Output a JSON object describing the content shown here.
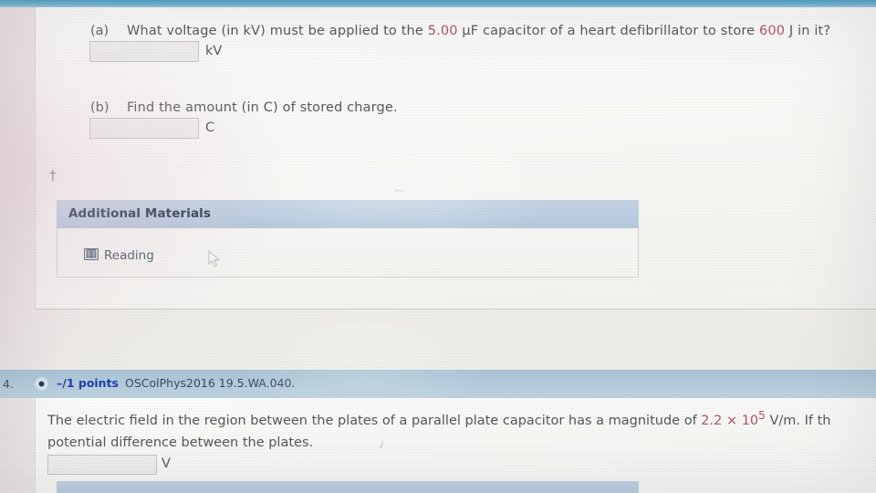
{
  "page": {
    "app": "online-homework-question-view"
  },
  "question3": {
    "parts": [
      {
        "label": "(a)",
        "text_before": "What voltage (in kV) must be applied to the ",
        "value1": "5.00",
        "text_mid": " µF capacitor of a heart defibrillator to store ",
        "value2": "600",
        "text_after": " J in it?",
        "input_value": "",
        "unit": "kV"
      },
      {
        "label": "(b)",
        "text_before": "Find the amount (in C) of stored charge.",
        "input_value": "",
        "unit": "C"
      }
    ],
    "footnote_marker": "†",
    "materials": {
      "header": "Additional Materials",
      "items": [
        {
          "icon": "book-icon",
          "label": "Reading"
        }
      ]
    }
  },
  "question4": {
    "number": "4.",
    "details_icon": "radio-dot-icon",
    "points": "–/1 points",
    "code": "OSColPhys2016 19.5.WA.040.",
    "line1_before": "The electric field in the region between the plates of a parallel plate capacitor has a magnitude of ",
    "line1_value": "2.2",
    "line1_times": " × 10",
    "line1_exp": "5",
    "line1_after": " V/m. If th",
    "line2": "potential difference between the plates.",
    "input_value": "",
    "unit": "V"
  },
  "colors": {
    "accent_blue": "#1f3fa8",
    "value_red": "#b05563",
    "panel_header_blue": "#bccde0",
    "question_header_blue": "#b2cada",
    "body_text": "#55585c"
  }
}
